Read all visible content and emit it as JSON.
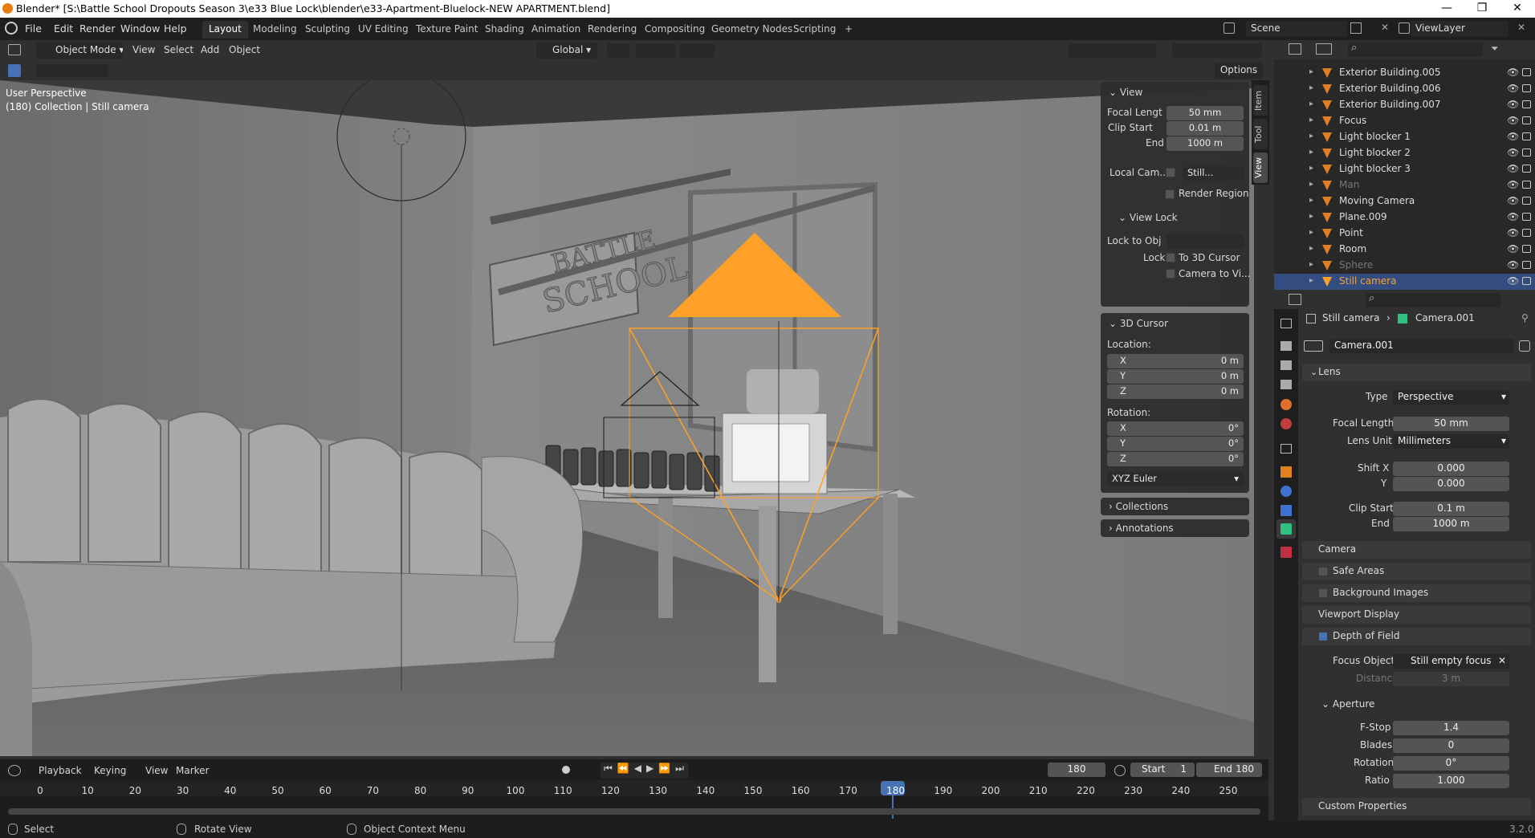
{
  "window": {
    "title": "Blender* [S:\\Battle School Dropouts Season 3\\e33 Blue Lock\\blender\\e33-Apartment-Bluelock-NEW APARTMENT.blend]",
    "minimize": "—",
    "maximize": "❐",
    "close": "✕"
  },
  "menu": [
    "File",
    "Edit",
    "Render",
    "Window",
    "Help"
  ],
  "workspaces": [
    "Layout",
    "Modeling",
    "Sculpting",
    "UV Editing",
    "Texture Paint",
    "Shading",
    "Animation",
    "Rendering",
    "Compositing",
    "Geometry Nodes",
    "Scripting",
    "+"
  ],
  "active_workspace": "Layout",
  "scene": "Scene",
  "view_layer": "ViewLayer",
  "viewport_header": {
    "mode": "Object Mode",
    "menus": [
      "View",
      "Select",
      "Add",
      "Object"
    ],
    "transform_orientation": "Global",
    "options": "Options"
  },
  "viewport": {
    "perspective": "User Perspective",
    "context": "(180) Collection | Still camera"
  },
  "npanel": {
    "tabs": [
      "Item",
      "Tool",
      "View"
    ],
    "view": {
      "title": "View",
      "focal_label": "Focal Lengt",
      "focal_value": "50 mm",
      "clip_start_label": "Clip Start",
      "clip_start_value": "0.01 m",
      "clip_end_label": "End",
      "clip_end_value": "1000 m",
      "local_cam_label": "Local Cam...",
      "local_cam_value": "Still...",
      "render_region": "Render Region",
      "view_lock": "View Lock",
      "lock_to_obj": "Lock to Obj",
      "lock": "Lock",
      "to_3d_cursor": "To 3D Cursor",
      "camera_to_view": "Camera to Vi..."
    },
    "cursor": {
      "title": "3D Cursor",
      "location": "Location:",
      "loc": [
        {
          "axis": "X",
          "value": "0 m"
        },
        {
          "axis": "Y",
          "value": "0 m"
        },
        {
          "axis": "Z",
          "value": "0 m"
        }
      ],
      "rotation": "Rotation:",
      "rot": [
        {
          "axis": "X",
          "value": "0°"
        },
        {
          "axis": "Y",
          "value": "0°"
        },
        {
          "axis": "Z",
          "value": "0°"
        }
      ],
      "mode": "XYZ Euler"
    },
    "collections": "Collections",
    "annotations": "Annotations"
  },
  "outliner": [
    {
      "name": "Exterior Building.005",
      "selected": false,
      "dim": false
    },
    {
      "name": "Exterior Building.006",
      "selected": false,
      "dim": false
    },
    {
      "name": "Exterior Building.007",
      "selected": false,
      "dim": false
    },
    {
      "name": "Focus",
      "selected": false,
      "dim": false
    },
    {
      "name": "Light blocker 1",
      "selected": false,
      "dim": false
    },
    {
      "name": "Light blocker 2",
      "selected": false,
      "dim": false
    },
    {
      "name": "Light blocker 3",
      "selected": false,
      "dim": false
    },
    {
      "name": "Man",
      "selected": false,
      "dim": true
    },
    {
      "name": "Moving Camera",
      "selected": false,
      "dim": false
    },
    {
      "name": "Plane.009",
      "selected": false,
      "dim": false
    },
    {
      "name": "Point",
      "selected": false,
      "dim": false
    },
    {
      "name": "Room",
      "selected": false,
      "dim": false
    },
    {
      "name": "Sphere",
      "selected": false,
      "dim": true
    },
    {
      "name": "Still camera",
      "selected": true,
      "dim": false
    }
  ],
  "properties": {
    "breadcrumb_obj": "Still camera",
    "breadcrumb_data": "Camera.001",
    "datablock": "Camera.001",
    "lens": {
      "title": "Lens",
      "type_label": "Type",
      "type_value": "Perspective",
      "focal_label": "Focal Length",
      "focal_value": "50 mm",
      "unit_label": "Lens Unit",
      "unit_value": "Millimeters",
      "shiftx_label": "Shift X",
      "shiftx_value": "0.000",
      "shifty_label": "Y",
      "shifty_value": "0.000",
      "clip_start_label": "Clip Start",
      "clip_start_value": "0.1 m",
      "clip_end_label": "End",
      "clip_end_value": "1000 m"
    },
    "camera": "Camera",
    "safe_areas": "Safe Areas",
    "background_images": "Background Images",
    "viewport_display": "Viewport Display",
    "dof": {
      "title": "Depth of Field",
      "focus_label": "Focus Object",
      "focus_value": "Still empty focus",
      "distance_label": "Distance",
      "distance_value": "3 m",
      "aperture": "Aperture",
      "fstop_label": "F-Stop",
      "fstop_value": "1.4",
      "blades_label": "Blades",
      "blades_value": "0",
      "rotation_label": "Rotation",
      "rotation_value": "0°",
      "ratio_label": "Ratio",
      "ratio_value": "1.000"
    },
    "custom_properties": "Custom Properties"
  },
  "timeline": {
    "menus": [
      "Playback",
      "Keying",
      "View",
      "Marker"
    ],
    "current_frame": "180",
    "start_label": "Start",
    "start_value": "1",
    "end_label": "End",
    "end_value": "180",
    "ticks": [
      "0",
      "10",
      "20",
      "30",
      "40",
      "50",
      "60",
      "70",
      "80",
      "90",
      "100",
      "110",
      "120",
      "130",
      "140",
      "150",
      "160",
      "170",
      "180",
      "190",
      "200",
      "210",
      "220",
      "230",
      "240",
      "250"
    ]
  },
  "statusbar": {
    "select": "Select",
    "rotate": "Rotate View",
    "context": "Object Context Menu",
    "version": "3.2.0"
  },
  "colors": {
    "accent": "#4772b3",
    "selection": "#334d80",
    "camera_orange": "#ffa028"
  }
}
